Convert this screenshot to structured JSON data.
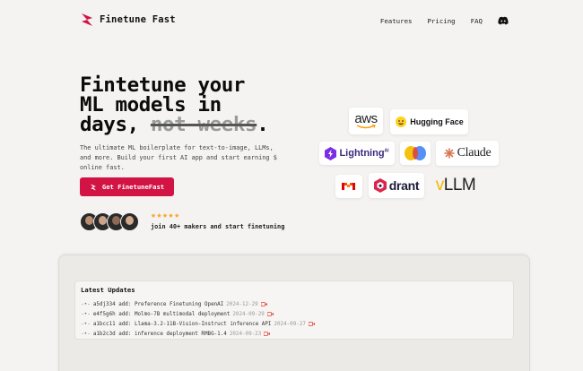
{
  "brand": {
    "name": "Finetune Fast",
    "accent": "#d11443"
  },
  "nav": {
    "features": "Features",
    "pricing": "Pricing",
    "faq": "FAQ"
  },
  "hero": {
    "title_line1": "Fintetune your",
    "title_line2": "ML models in",
    "title_line3_prefix": "days, ",
    "title_strike": "not weeks",
    "title_suffix": ".",
    "subtitle": "The ultimate ML boilerplate for text-to-image, LLMs, and more. Build your first AI app and start earning $ online fast.",
    "cta_label": "Get FinetuneFast",
    "stars": "★★★★★",
    "social_proof": "join 40+ makers and start finetuning"
  },
  "logos": {
    "aws": "aws",
    "huggingface": "Hugging Face",
    "lightning": "Lightning",
    "lightning_sup": "AI",
    "claude": "Claude",
    "qdrant": "drant",
    "vllm_v": "v",
    "vllm_rest": "LLM"
  },
  "updates": {
    "title": "Latest Updates",
    "commits": [
      {
        "hash": "a5dj334",
        "message": "add: Preference Finetuning OpenAI",
        "date": "2024-12-29"
      },
      {
        "hash": "e4f5g6h",
        "message": "add: Molmo-7B multimodal deployment",
        "date": "2024-09-29"
      },
      {
        "hash": "a1bcc11",
        "message": "add: Llama-3.2-11B-Vision-Instruct inference API",
        "date": "2024-09-27"
      },
      {
        "hash": "a1b2c3d",
        "message": "add: inference deployment RMBG-1.4",
        "date": "2024-09-23"
      }
    ]
  }
}
